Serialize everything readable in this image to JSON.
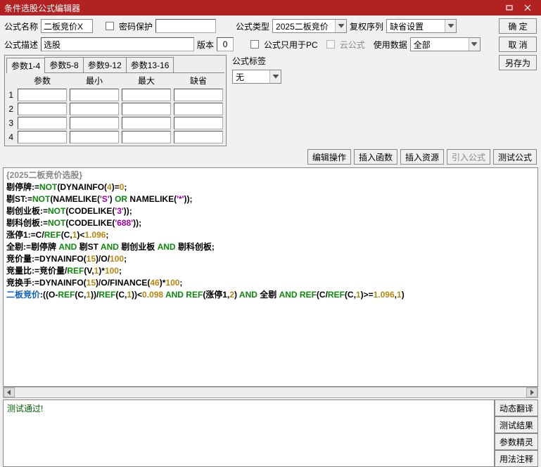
{
  "title": "条件选股公式编辑器",
  "labels": {
    "name": "公式名称",
    "pwd": "密码保护",
    "type": "公式类型",
    "restore": "复权序列",
    "desc": "公式描述",
    "version": "版本",
    "pcOnly": "公式只用于PC",
    "cloud": "云公式",
    "useData": "使用数据",
    "tag": "公式标签"
  },
  "values": {
    "name": "二板竞价X",
    "desc": "选股",
    "version": "0",
    "type": "2025二板竞价",
    "restore": "缺省设置",
    "useData": "全部",
    "tag": "无"
  },
  "buttons": {
    "ok": "确 定",
    "cancel": "取 消",
    "saveAs": "另存为",
    "editOp": "编辑操作",
    "insFunc": "插入函数",
    "insRes": "插入资源",
    "importF": "引入公式",
    "testF": "测试公式"
  },
  "paramTabs": [
    "参数1-4",
    "参数5-8",
    "参数9-12",
    "参数13-16"
  ],
  "paramHeaders": [
    "参数",
    "最小",
    "最大",
    "缺省"
  ],
  "paramRows": [
    "1",
    "2",
    "3",
    "4"
  ],
  "code": {
    "header": "{2025二板竞价选股}",
    "l1a": "剔停牌:=",
    "l1b": "NOT",
    "l1c": "(DYNAINFO(",
    "l1d": "4",
    "l1e": ")=",
    "l1f": "0",
    "l1g": ";",
    "l2a": "剔ST:=",
    "l2b": "NOT",
    "l2c": "(NAMELIKE(",
    "l2d": "'S'",
    "l2e": ") ",
    "l2f": "OR",
    "l2g": " NAMELIKE(",
    "l2h": "'*'",
    "l2i": "));",
    "l3a": "剔创业板:=",
    "l3b": "NOT",
    "l3c": "(CODELIKE(",
    "l3d": "'3'",
    "l3e": "));",
    "l4a": "剔科创板:=",
    "l4b": "NOT",
    "l4c": "(CODELIKE(",
    "l4d": "'688'",
    "l4e": "));",
    "l5a": "涨停1:=C/",
    "l5b": "REF",
    "l5c": "(C,",
    "l5d": "1",
    "l5e": ")<",
    "l5f": "1.096",
    "l5g": ";",
    "l6a": "全剔:=剔停牌 ",
    "l6b": "AND",
    "l6c": " 剔ST ",
    "l6d": "AND",
    "l6e": " 剔创业板 ",
    "l6f": "AND",
    "l6g": " 剔科创板;",
    "l7a": "竞价量:=DYNAINFO(",
    "l7b": "15",
    "l7c": ")/O/",
    "l7d": "100",
    "l7e": ";",
    "l8a": "竞量比:=竞价量/",
    "l8b": "REF",
    "l8c": "(V,",
    "l8d": "1",
    "l8e": ")*",
    "l8f": "100",
    "l8g": ";",
    "l9a": "竞换手:=DYNAINFO(",
    "l9b": "15",
    "l9c": ")/O/FINANCE(",
    "l9d": "46",
    "l9e": ")*",
    "l9f": "100",
    "l9g": ";",
    "l10a": "二板竞价",
    "l10b": ":((O-",
    "l10c": "REF",
    "l10d": "(C,",
    "l10e": "1",
    "l10f": "))/",
    "l10g": "REF",
    "l10h": "(C,",
    "l10i": "1",
    "l10j": "))<",
    "l10k": "0.098",
    "l10l": " AND",
    "l10m": " REF",
    "l10n": "(涨停1,",
    "l10o": "2",
    "l10p": ") ",
    "l10q": "AND",
    "l10r": " 全剔 ",
    "l10s": "AND",
    "l10t": " REF",
    "l10u": "(C/",
    "l10v": "REF",
    "l10w": "(C,",
    "l10x": "1",
    "l10y": ")>=",
    "l10z": "1.096",
    "l10aa": ",",
    "l10ab": "1",
    "l10ac": ")"
  },
  "result": "测试通过!",
  "sideButtons": [
    "动态翻译",
    "测试结果",
    "参数精灵",
    "用法注释"
  ]
}
